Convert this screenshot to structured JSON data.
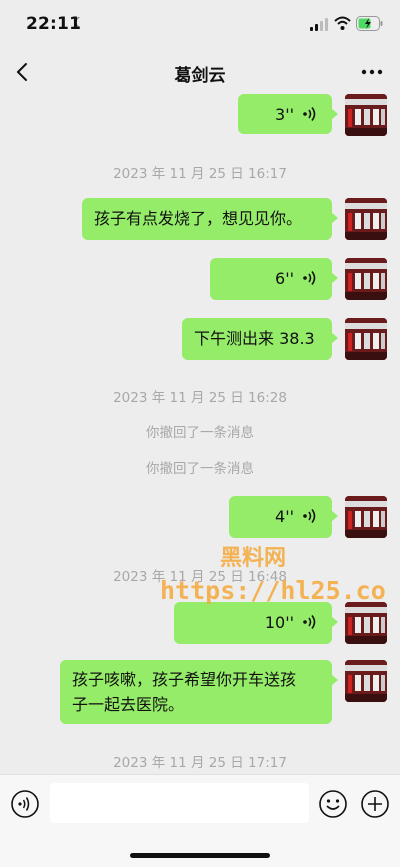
{
  "status": {
    "time": "22:11",
    "battery_color": "#4cd964"
  },
  "header": {
    "title": "葛剑云"
  },
  "messages": [
    {
      "kind": "voice",
      "duration": "3''"
    },
    {
      "kind": "time",
      "text": "2023 年 11 月 25 日 16:17"
    },
    {
      "kind": "text",
      "text": "孩子有点发烧了，想见见你。"
    },
    {
      "kind": "voice",
      "duration": "6''"
    },
    {
      "kind": "text",
      "text": "下午测出来 38.3"
    },
    {
      "kind": "time",
      "text": "2023 年 11 月 25 日 16:28"
    },
    {
      "kind": "system",
      "text": "你撤回了一条消息"
    },
    {
      "kind": "system",
      "text": "你撤回了一条消息"
    },
    {
      "kind": "voice",
      "duration": "4''"
    },
    {
      "kind": "time",
      "text": "2023 年 11 月 25 日 16:48"
    },
    {
      "kind": "voice",
      "duration": "10''"
    },
    {
      "kind": "text",
      "line1": "孩子咳嗽，孩子希望你开车送孩",
      "line2": "子一起去医院。"
    },
    {
      "kind": "time",
      "text": "2023 年 11 月 25 日 17:17"
    }
  ],
  "watermark": {
    "line1": "黑料网",
    "line2": "https://hl25.co"
  },
  "colors": {
    "bubble": "#95ec69",
    "background": "#ededed",
    "watermark": "#f5a83a"
  }
}
